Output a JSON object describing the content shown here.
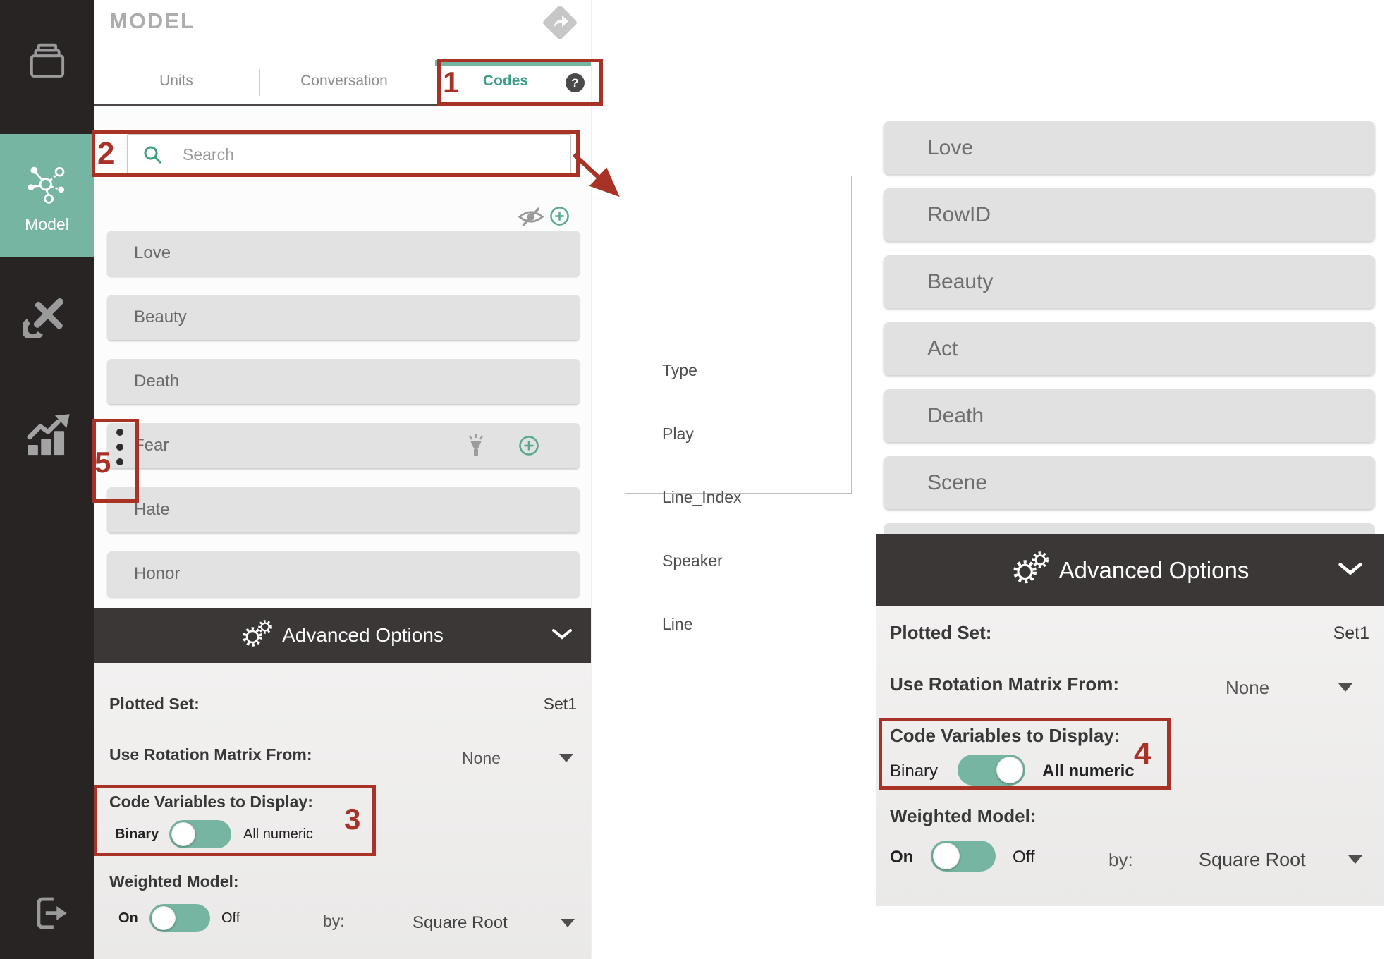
{
  "colors": {
    "teal": "#76b5a2",
    "teal_text": "#3e9e88",
    "annotation_red": "#a93226",
    "header_dark": "#3b3737",
    "sidebar_dark": "#282424"
  },
  "sidebar": {
    "model_label": "Model"
  },
  "panel": {
    "title": "MODEL",
    "tabs": {
      "units": "Units",
      "conversation": "Conversation",
      "codes": "Codes",
      "help_glyph": "?"
    },
    "search": {
      "placeholder": "Search",
      "value": ""
    },
    "codes": {
      "items": [
        "Love",
        "Beauty",
        "Death",
        "Fear",
        "Hate",
        "Honor"
      ]
    },
    "advanced": {
      "header": "Advanced Options",
      "plotted_set_label": "Plotted Set:",
      "plotted_set_value": "Set1",
      "rotation_label": "Use Rotation Matrix From:",
      "rotation_value": "None",
      "code_vars_label": "Code Variables to Display:",
      "binary_label": "Binary",
      "all_numeric_label": "All numeric",
      "code_vars_selected": "Binary",
      "weighted_label": "Weighted Model:",
      "on_label": "On",
      "off_label": "Off",
      "weighted_selected": "On",
      "by_label": "by:",
      "weight_method": "Square Root"
    }
  },
  "dropdown": {
    "items": [
      "Type",
      "Play",
      "Line_Index",
      "Speaker",
      "Line"
    ]
  },
  "right_panel": {
    "codes": [
      "Love",
      "RowID",
      "Beauty",
      "Act",
      "Death",
      "Scene"
    ],
    "advanced": {
      "header": "Advanced Options",
      "plotted_set_label": "Plotted Set:",
      "plotted_set_value": "Set1",
      "rotation_label": "Use Rotation Matrix From:",
      "rotation_value": "None",
      "code_vars_label": "Code Variables to Display:",
      "binary_label": "Binary",
      "all_numeric_label": "All numeric",
      "code_vars_selected": "All numeric",
      "weighted_label": "Weighted Model:",
      "on_label": "On",
      "off_label": "Off",
      "weighted_selected": "On",
      "by_label": "by:",
      "weight_method": "Square Root"
    }
  },
  "annotations": {
    "n1": "1",
    "n2": "2",
    "n3": "3",
    "n4": "4",
    "n5": "5"
  }
}
